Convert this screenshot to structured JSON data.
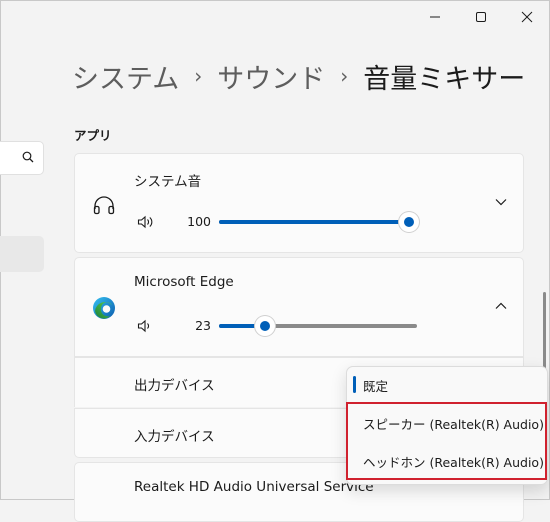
{
  "window": {
    "minimize_icon": "minimize-icon",
    "maximize_icon": "maximize-icon",
    "close_icon": "close-icon"
  },
  "breadcrumb": {
    "items": [
      "システム",
      "サウンド"
    ],
    "separator": "›",
    "current": "音量ミキサー"
  },
  "sidebar": {
    "search_icon": "search-icon"
  },
  "section": {
    "title": "アプリ"
  },
  "apps": [
    {
      "name": "システム音",
      "icon": "headphones-icon",
      "volume": 100,
      "volume_label": "100",
      "expanded": false,
      "chevron": "chevron-down-icon"
    },
    {
      "name": "Microsoft Edge",
      "icon": "edge-logo-icon",
      "volume": 23,
      "volume_label": "23",
      "expanded": true,
      "chevron": "chevron-up-icon",
      "output_device_label": "出力デバイス",
      "input_device_label": "入力デバイス"
    },
    {
      "name": "Realtek HD Audio Universal Service"
    }
  ],
  "output_dropdown": {
    "options": [
      "既定",
      "スピーカー (Realtek(R) Audio)",
      "ヘッドホン (Realtek(R) Audio)"
    ],
    "selected_index": 0
  },
  "colors": {
    "accent": "#005fb8",
    "highlight": "#d0212e"
  }
}
